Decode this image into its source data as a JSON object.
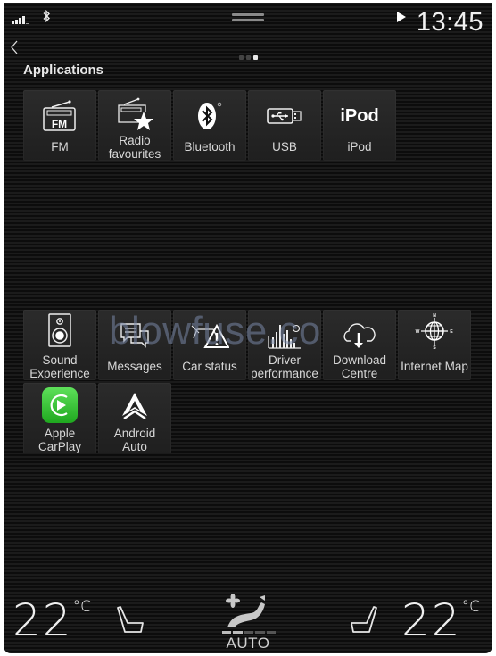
{
  "status_bar": {
    "signal_icon": "signal-strength-icon",
    "bluetooth_icon": "bluetooth-icon",
    "handle_icon": "drag-handle-icon",
    "media_icon": "play-icon",
    "time": "13:45"
  },
  "nav": {
    "back_icon": "chevron-left-icon",
    "page_count": 3,
    "active_page": 3
  },
  "section": {
    "title": "Applications"
  },
  "apps_row1": [
    {
      "label": "FM",
      "icon": "fm-radio-icon"
    },
    {
      "label_lines": [
        "Radio",
        "favourites"
      ],
      "icon": "radio-favourites-icon"
    },
    {
      "label": "Bluetooth",
      "icon": "bluetooth-icon"
    },
    {
      "label": "USB",
      "icon": "usb-icon"
    },
    {
      "label": "iPod",
      "icon": "ipod-icon",
      "icon_text": "iPod"
    }
  ],
  "apps_row2": [
    {
      "label_lines": [
        "Sound",
        "Experience"
      ],
      "icon": "speaker-icon"
    },
    {
      "label": "Messages",
      "icon": "messages-icon"
    },
    {
      "label": "Car status",
      "icon": "car-status-icon"
    },
    {
      "label_lines": [
        "Driver",
        "performance"
      ],
      "icon": "driver-performance-icon"
    },
    {
      "label_lines": [
        "Download",
        "Centre"
      ],
      "icon": "cloud-download-icon"
    },
    {
      "label": "Internet Map",
      "icon": "compass-globe-icon",
      "compass": [
        "N",
        "E",
        "S",
        "W"
      ]
    }
  ],
  "apps_row3": [
    {
      "label_lines": [
        "Apple",
        "CarPlay"
      ],
      "icon": "carplay-icon",
      "color": "#3cc43a"
    },
    {
      "label_lines": [
        "Android",
        "Auto"
      ],
      "icon": "android-auto-icon"
    }
  ],
  "watermark": "blowfuse.co",
  "climate": {
    "left_temp": "22",
    "right_temp": "22",
    "unit": "°C",
    "left_seat_icon": "seat-heat-left-icon",
    "right_seat_icon": "seat-heat-right-icon",
    "fan_icon": "fan-airflow-icon",
    "fan_mode": "AUTO",
    "fan_level_segments": 5,
    "fan_level_active": 2
  }
}
